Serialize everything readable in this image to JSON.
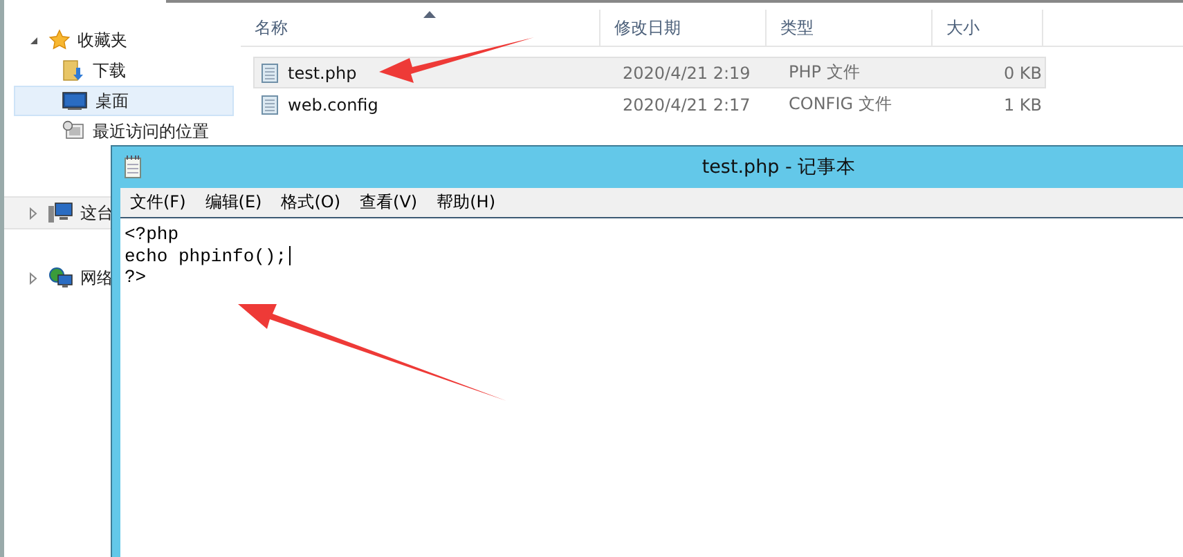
{
  "explorer": {
    "sidebar": [
      {
        "label": "收藏夹",
        "kind": "favorites",
        "expanded": true,
        "children": [
          {
            "label": "下载",
            "kind": "download",
            "selected": false
          },
          {
            "label": "桌面",
            "kind": "desktop",
            "selected": true
          },
          {
            "label": "最近访问的位置",
            "kind": "recent",
            "selected": false
          }
        ]
      },
      {
        "label": "这台",
        "kind": "computer",
        "expanded": false
      },
      {
        "label": "网络",
        "kind": "network",
        "expanded": false
      }
    ],
    "columns": [
      {
        "label": "名称",
        "sorted": true
      },
      {
        "label": "修改日期",
        "sorted": false
      },
      {
        "label": "类型",
        "sorted": false
      },
      {
        "label": "大小",
        "sorted": false
      }
    ],
    "rows": [
      {
        "name": "test.php",
        "modified": "2020/4/21 2:19",
        "type": "PHP 文件",
        "size": "0 KB",
        "selected": true
      },
      {
        "name": "web.config",
        "modified": "2020/4/21 2:17",
        "type": "CONFIG 文件",
        "size": "1 KB",
        "selected": false
      }
    ]
  },
  "notepad": {
    "title": "test.php - 记事本",
    "menu": [
      "文件(F)",
      "编辑(E)",
      "格式(O)",
      "查看(V)",
      "帮助(H)"
    ],
    "content": [
      "<?php",
      "echo phpinfo();",
      "?>"
    ]
  }
}
